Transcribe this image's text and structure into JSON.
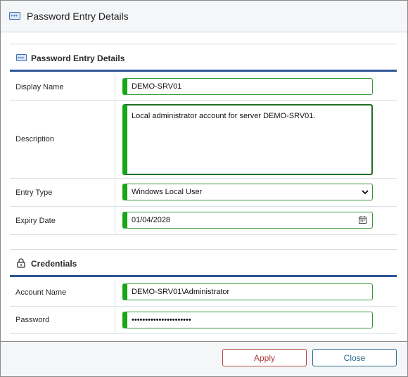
{
  "window": {
    "title": "Password Entry Details",
    "title_icon": "password-entry-icon"
  },
  "sections": {
    "details": {
      "title": "Password Entry Details",
      "icon": "password-entry-icon",
      "fields": {
        "display_name": {
          "label": "Display Name",
          "value": "DEMO-SRV01"
        },
        "description": {
          "label": "Description",
          "value": "Local administrator account for server DEMO-SRV01."
        },
        "entry_type": {
          "label": "Entry Type",
          "value": "Windows Local User"
        },
        "expiry_date": {
          "label": "Expiry Date",
          "value": "01/04/2028"
        }
      }
    },
    "credentials": {
      "title": "Credentials",
      "icon": "lock-icon",
      "fields": {
        "account_name": {
          "label": "Account Name",
          "value": "DEMO-SRV01\\Administrator"
        },
        "password": {
          "label": "Password",
          "value": "••••••••••••••••••••••"
        }
      }
    }
  },
  "footer": {
    "apply_label": "Apply",
    "close_label": "Close"
  },
  "colors": {
    "field_accent": "#16a716",
    "section_rule": "#2f5597",
    "apply_border": "#b04545",
    "close_border": "#2f6d8f"
  }
}
